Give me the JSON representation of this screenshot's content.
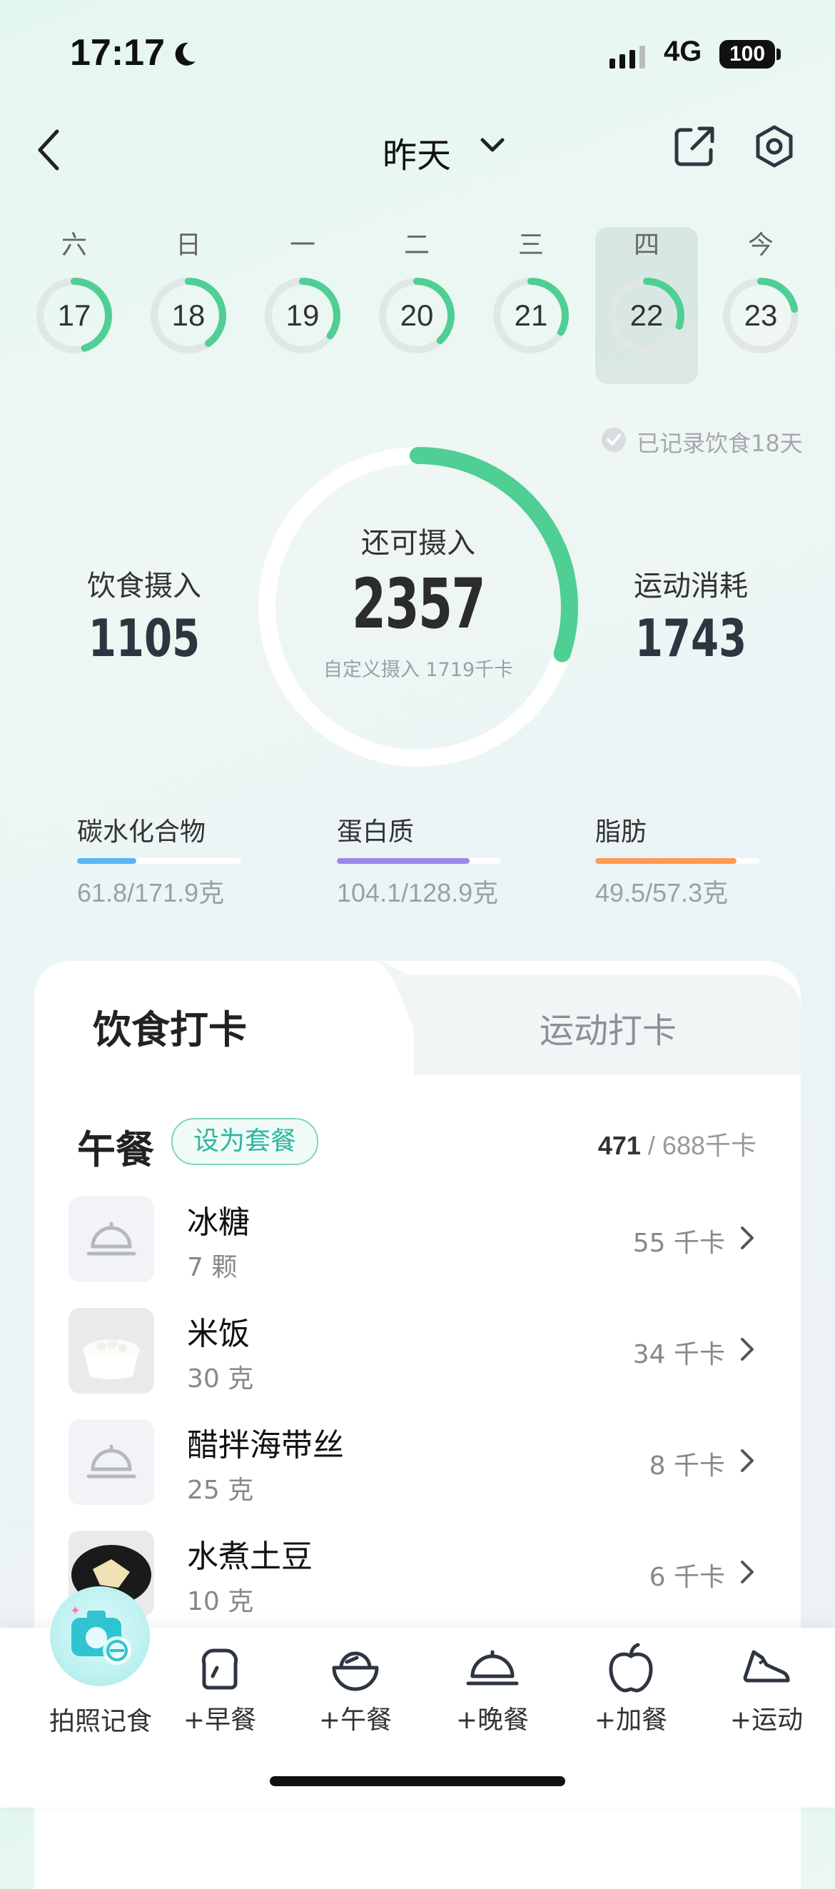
{
  "status_bar": {
    "time": "17:17",
    "network": "4G",
    "battery": "100"
  },
  "header": {
    "title": "昨天"
  },
  "week": [
    {
      "label": "六",
      "date": "17",
      "progress": 0.45
    },
    {
      "label": "日",
      "date": "18",
      "progress": 0.4
    },
    {
      "label": "一",
      "date": "19",
      "progress": 0.35
    },
    {
      "label": "二",
      "date": "20",
      "progress": 0.38
    },
    {
      "label": "三",
      "date": "21",
      "progress": 0.33
    },
    {
      "label": "四",
      "date": "22",
      "progress": 0.3,
      "selected": true
    },
    {
      "label": "今",
      "date": "23",
      "progress": 0.22
    }
  ],
  "recorded_text": "已记录饮食18天",
  "summary": {
    "intake_label": "饮食摄入",
    "intake_value": "1105",
    "remaining_label": "还可摄入",
    "remaining_value": "2357",
    "custom_text": "自定义摄入 1719千卡",
    "exercise_label": "运动消耗",
    "exercise_value": "1743",
    "ring_progress": 0.3
  },
  "macros": [
    {
      "label": "碳水化合物",
      "value": "61.8/171.9克",
      "fraction": 0.36,
      "color": "#5ab4f5"
    },
    {
      "label": "蛋白质",
      "value": "104.1/128.9克",
      "fraction": 0.81,
      "color": "#9d87e6"
    },
    {
      "label": "脂肪",
      "value": "49.5/57.3克",
      "fraction": 0.86,
      "color": "#ff9a55"
    }
  ],
  "tabs": {
    "active": "饮食打卡",
    "inactive": "运动打卡"
  },
  "meal": {
    "title": "午餐",
    "set_label": "设为套餐",
    "kcal_eaten": "471",
    "kcal_sep": " / ",
    "kcal_target": "688千卡"
  },
  "foods": [
    {
      "name": "冰糖",
      "qty": "7 颗",
      "kcal": "55 千卡",
      "thumb": "dish-icon"
    },
    {
      "name": "米饭",
      "qty": "30 克",
      "kcal": "34 千卡",
      "thumb": "rice-photo"
    },
    {
      "name": "醋拌海带丝",
      "qty": "25 克",
      "kcal": "8 千卡",
      "thumb": "dish-icon"
    },
    {
      "name": "水煮土豆",
      "qty": "10 克",
      "kcal": "6 千卡",
      "thumb": "potato-photo"
    }
  ],
  "bottom_bar": {
    "camera": "拍照记食",
    "items": [
      {
        "label": "+早餐",
        "icon": "toast-icon"
      },
      {
        "label": "+午餐",
        "icon": "bowl-icon"
      },
      {
        "label": "+晚餐",
        "icon": "cloche-icon"
      },
      {
        "label": "+加餐",
        "icon": "apple-icon"
      },
      {
        "label": "+运动",
        "icon": "shoe-icon"
      }
    ]
  },
  "colors": {
    "accent": "#4fcf93",
    "ring_track": "#ffffff"
  }
}
